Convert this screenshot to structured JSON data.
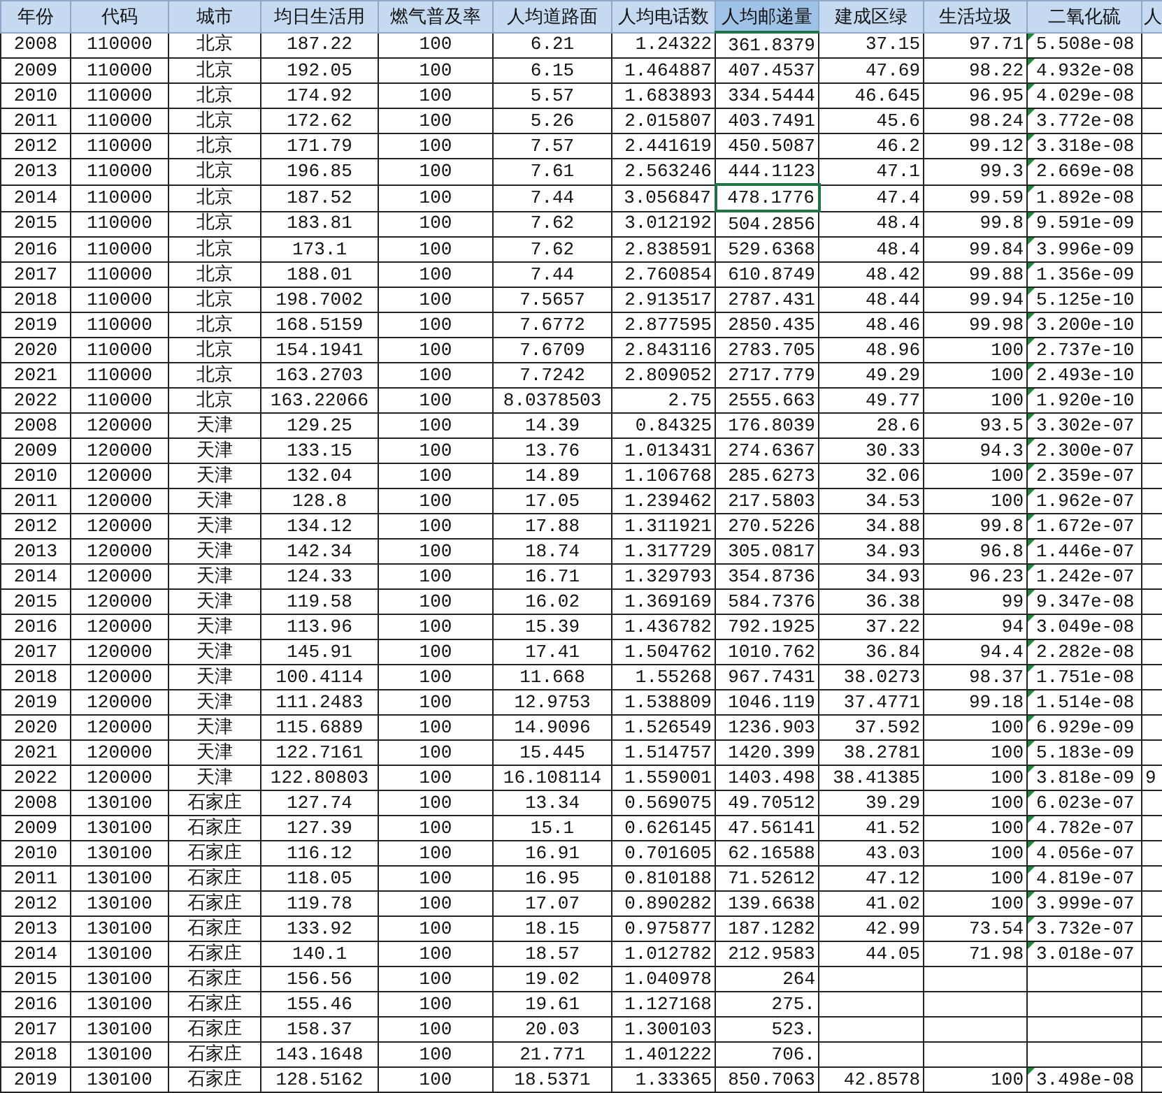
{
  "columns": [
    {
      "header": "年份",
      "kind": "label",
      "selected": false
    },
    {
      "header": "代码",
      "kind": "label",
      "selected": false
    },
    {
      "header": "城市",
      "kind": "label",
      "selected": false
    },
    {
      "header": "均日生活用",
      "kind": "label",
      "selected": false
    },
    {
      "header": "燃气普及率",
      "kind": "label",
      "selected": false
    },
    {
      "header": "人均道路面",
      "kind": "label",
      "selected": false
    },
    {
      "header": "人均电话数",
      "kind": "number",
      "selected": false
    },
    {
      "header": "人均邮递量",
      "kind": "number",
      "selected": true
    },
    {
      "header": "建成区绿",
      "kind": "number",
      "selected": false
    },
    {
      "header": "生活垃圾",
      "kind": "number",
      "selected": false
    },
    {
      "header": "二氧化硫",
      "kind": "flagged",
      "selected": false
    },
    {
      "header": "人",
      "kind": "text",
      "selected": false
    }
  ],
  "rows": [
    {
      "selected": false,
      "cells": [
        "2008",
        "110000",
        "北京",
        "187.22",
        "100",
        "6.21",
        "1.24322",
        "361.8379",
        "37.15",
        "97.71",
        "5.508e-08"
      ]
    },
    {
      "selected": false,
      "cells": [
        "2009",
        "110000",
        "北京",
        "192.05",
        "100",
        "6.15",
        "1.464887",
        "407.4537",
        "47.69",
        "98.22",
        "4.932e-08"
      ]
    },
    {
      "selected": false,
      "cells": [
        "2010",
        "110000",
        "北京",
        "174.92",
        "100",
        "5.57",
        "1.683893",
        "334.5444",
        "46.645",
        "96.95",
        "4.029e-08"
      ]
    },
    {
      "selected": false,
      "cells": [
        "2011",
        "110000",
        "北京",
        "172.62",
        "100",
        "5.26",
        "2.015807",
        "403.7491",
        "45.6",
        "98.24",
        "3.772e-08"
      ]
    },
    {
      "selected": false,
      "cells": [
        "2012",
        "110000",
        "北京",
        "171.79",
        "100",
        "7.57",
        "2.441619",
        "450.5087",
        "46.2",
        "99.12",
        "3.318e-08"
      ]
    },
    {
      "selected": false,
      "cells": [
        "2013",
        "110000",
        "北京",
        "196.85",
        "100",
        "7.61",
        "2.563246",
        "444.1123",
        "47.1",
        "99.3",
        "2.669e-08"
      ]
    },
    {
      "selected": true,
      "cells": [
        "2014",
        "110000",
        "北京",
        "187.52",
        "100",
        "7.44",
        "3.056847",
        "478.1776",
        "47.4",
        "99.59",
        "1.892e-08"
      ]
    },
    {
      "selected": false,
      "cells": [
        "2015",
        "110000",
        "北京",
        "183.81",
        "100",
        "7.62",
        "3.012192",
        "504.2856",
        "48.4",
        "99.8",
        "9.591e-09"
      ]
    },
    {
      "selected": false,
      "cells": [
        "2016",
        "110000",
        "北京",
        "173.1",
        "100",
        "7.62",
        "2.838591",
        "529.6368",
        "48.4",
        "99.84",
        "3.996e-09"
      ]
    },
    {
      "selected": false,
      "cells": [
        "2017",
        "110000",
        "北京",
        "188.01",
        "100",
        "7.44",
        "2.760854",
        "610.8749",
        "48.42",
        "99.88",
        "1.356e-09"
      ]
    },
    {
      "selected": false,
      "cells": [
        "2018",
        "110000",
        "北京",
        "198.7002",
        "100",
        "7.5657",
        "2.913517",
        "2787.431",
        "48.44",
        "99.94",
        "5.125e-10"
      ]
    },
    {
      "selected": false,
      "cells": [
        "2019",
        "110000",
        "北京",
        "168.5159",
        "100",
        "7.6772",
        "2.877595",
        "2850.435",
        "48.46",
        "99.98",
        "3.200e-10"
      ]
    },
    {
      "selected": false,
      "cells": [
        "2020",
        "110000",
        "北京",
        "154.1941",
        "100",
        "7.6709",
        "2.843116",
        "2783.705",
        "48.96",
        "100",
        "2.737e-10"
      ]
    },
    {
      "selected": false,
      "cells": [
        "2021",
        "110000",
        "北京",
        "163.2703",
        "100",
        "7.7242",
        "2.809052",
        "2717.779",
        "49.29",
        "100",
        "2.493e-10"
      ]
    },
    {
      "selected": false,
      "cells": [
        "2022",
        "110000",
        "北京",
        "163.22066",
        "100",
        "8.0378503",
        "2.75",
        "2555.663",
        "49.77",
        "100",
        "1.920e-10"
      ]
    },
    {
      "selected": false,
      "cells": [
        "2008",
        "120000",
        "天津",
        "129.25",
        "100",
        "14.39",
        "0.84325",
        "176.8039",
        "28.6",
        "93.5",
        "3.302e-07"
      ]
    },
    {
      "selected": false,
      "cells": [
        "2009",
        "120000",
        "天津",
        "133.15",
        "100",
        "13.76",
        "1.013431",
        "274.6367",
        "30.33",
        "94.3",
        "2.300e-07"
      ]
    },
    {
      "selected": false,
      "cells": [
        "2010",
        "120000",
        "天津",
        "132.04",
        "100",
        "14.89",
        "1.106768",
        "285.6273",
        "32.06",
        "100",
        "2.359e-07"
      ]
    },
    {
      "selected": false,
      "cells": [
        "2011",
        "120000",
        "天津",
        "128.8",
        "100",
        "17.05",
        "1.239462",
        "217.5803",
        "34.53",
        "100",
        "1.962e-07"
      ]
    },
    {
      "selected": false,
      "cells": [
        "2012",
        "120000",
        "天津",
        "134.12",
        "100",
        "17.88",
        "1.311921",
        "270.5226",
        "34.88",
        "99.8",
        "1.672e-07"
      ]
    },
    {
      "selected": false,
      "cells": [
        "2013",
        "120000",
        "天津",
        "142.34",
        "100",
        "18.74",
        "1.317729",
        "305.0817",
        "34.93",
        "96.8",
        "1.446e-07"
      ]
    },
    {
      "selected": false,
      "cells": [
        "2014",
        "120000",
        "天津",
        "124.33",
        "100",
        "16.71",
        "1.329793",
        "354.8736",
        "34.93",
        "96.23",
        "1.242e-07"
      ]
    },
    {
      "selected": false,
      "cells": [
        "2015",
        "120000",
        "天津",
        "119.58",
        "100",
        "16.02",
        "1.369169",
        "584.7376",
        "36.38",
        "99",
        "9.347e-08"
      ]
    },
    {
      "selected": false,
      "cells": [
        "2016",
        "120000",
        "天津",
        "113.96",
        "100",
        "15.39",
        "1.436782",
        "792.1925",
        "37.22",
        "94",
        "3.049e-08"
      ]
    },
    {
      "selected": false,
      "cells": [
        "2017",
        "120000",
        "天津",
        "145.91",
        "100",
        "17.41",
        "1.504762",
        "1010.762",
        "36.84",
        "94.4",
        "2.282e-08"
      ]
    },
    {
      "selected": false,
      "cells": [
        "2018",
        "120000",
        "天津",
        "100.4114",
        "100",
        "11.668",
        "1.55268",
        "967.7431",
        "38.0273",
        "98.37",
        "1.751e-08"
      ]
    },
    {
      "selected": false,
      "cells": [
        "2019",
        "120000",
        "天津",
        "111.2483",
        "100",
        "12.9753",
        "1.538809",
        "1046.119",
        "37.4771",
        "99.18",
        "1.514e-08"
      ]
    },
    {
      "selected": false,
      "cells": [
        "2020",
        "120000",
        "天津",
        "115.6889",
        "100",
        "14.9096",
        "1.526549",
        "1236.903",
        "37.592",
        "100",
        "6.929e-09"
      ]
    },
    {
      "selected": false,
      "cells": [
        "2021",
        "120000",
        "天津",
        "122.7161",
        "100",
        "15.445",
        "1.514757",
        "1420.399",
        "38.2781",
        "100",
        "5.183e-09"
      ]
    },
    {
      "selected": false,
      "cells": [
        "2022",
        "120000",
        "天津",
        "122.80803",
        "100",
        "16.108114",
        "1.559001",
        "1403.498",
        "38.41385",
        "100",
        "3.818e-09",
        "9"
      ]
    },
    {
      "selected": false,
      "cells": [
        "2008",
        "130100",
        "石家庄",
        "127.74",
        "100",
        "13.34",
        "0.569075",
        "49.70512",
        "39.29",
        "100",
        "6.023e-07"
      ]
    },
    {
      "selected": false,
      "cells": [
        "2009",
        "130100",
        "石家庄",
        "127.39",
        "100",
        "15.1",
        "0.626145",
        "47.56141",
        "41.52",
        "100",
        "4.782e-07"
      ]
    },
    {
      "selected": false,
      "cells": [
        "2010",
        "130100",
        "石家庄",
        "116.12",
        "100",
        "16.91",
        "0.701605",
        "62.16588",
        "43.03",
        "100",
        "4.056e-07"
      ]
    },
    {
      "selected": false,
      "cells": [
        "2011",
        "130100",
        "石家庄",
        "118.05",
        "100",
        "16.95",
        "0.810188",
        "71.52612",
        "47.12",
        "100",
        "4.819e-07"
      ]
    },
    {
      "selected": false,
      "cells": [
        "2012",
        "130100",
        "石家庄",
        "119.78",
        "100",
        "17.07",
        "0.890282",
        "139.6638",
        "41.02",
        "100",
        "3.999e-07"
      ]
    },
    {
      "selected": false,
      "cells": [
        "2013",
        "130100",
        "石家庄",
        "133.92",
        "100",
        "18.15",
        "0.975877",
        "187.1282",
        "42.99",
        "73.54",
        "3.732e-07"
      ]
    },
    {
      "selected": false,
      "cells": [
        "2014",
        "130100",
        "石家庄",
        "140.1",
        "100",
        "18.57",
        "1.012782",
        "212.9583",
        "44.05",
        "71.98",
        "3.018e-07"
      ]
    },
    {
      "selected": false,
      "cells": [
        "2015",
        "130100",
        "石家庄",
        "156.56",
        "100",
        "19.02",
        "1.040978",
        "264"
      ]
    },
    {
      "selected": false,
      "cells": [
        "2016",
        "130100",
        "石家庄",
        "155.46",
        "100",
        "19.61",
        "1.127168",
        "275."
      ]
    },
    {
      "selected": false,
      "cells": [
        "2017",
        "130100",
        "石家庄",
        "158.37",
        "100",
        "20.03",
        "1.300103",
        "523."
      ]
    },
    {
      "selected": false,
      "cells": [
        "2018",
        "130100",
        "石家庄",
        "143.1648",
        "100",
        "21.771",
        "1.401222",
        "706."
      ]
    },
    {
      "selected": false,
      "cells": [
        "2019",
        "130100",
        "石家庄",
        "128.5162",
        "100",
        "18.5371",
        "1.33365",
        "850.7063",
        "42.8578",
        "100",
        "3.498e-08"
      ]
    }
  ]
}
